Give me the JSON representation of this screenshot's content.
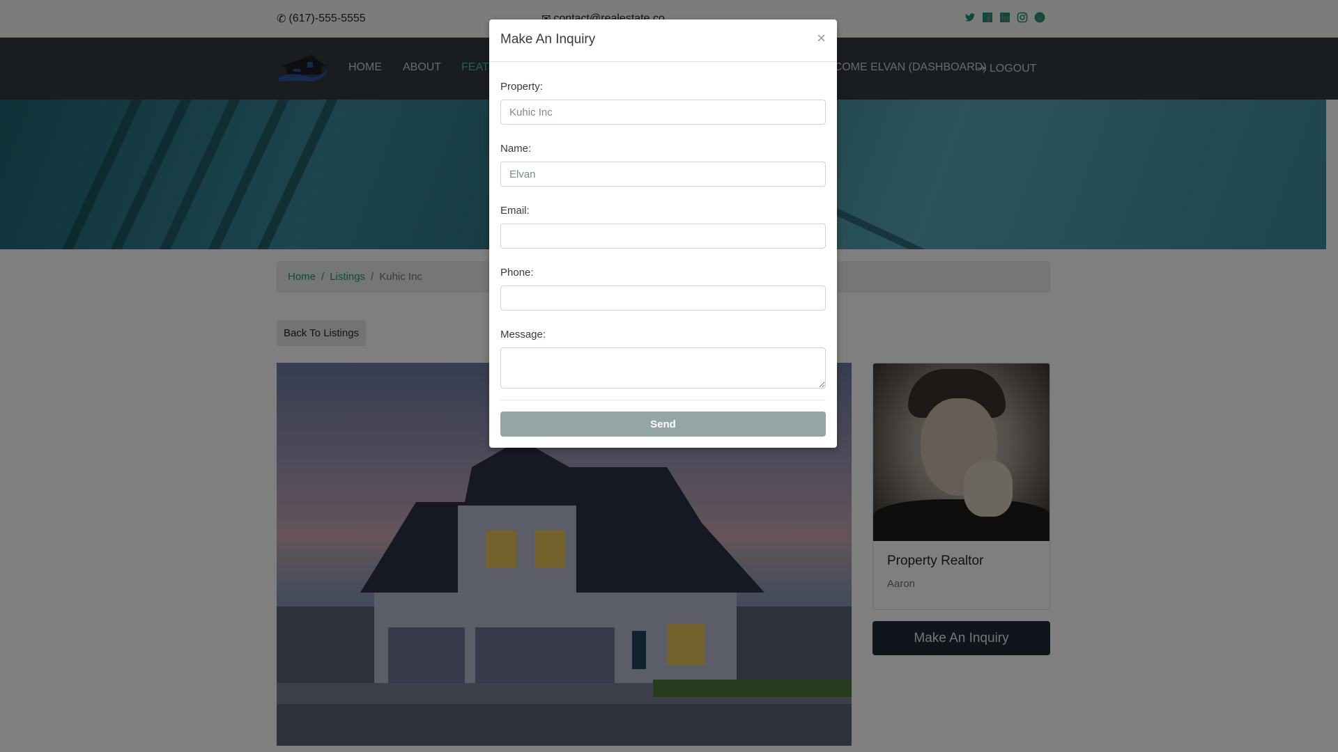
{
  "topbar": {
    "phone": "(617)-555-5555",
    "email": "contact@realestate.co",
    "social_icons": [
      "twitter-icon",
      "facebook-icon",
      "linkedin-icon",
      "instagram-icon",
      "pinterest-icon"
    ]
  },
  "nav": {
    "items": [
      {
        "label": "HOME"
      },
      {
        "label": "ABOUT"
      },
      {
        "label": "FEATURED LISTINGS",
        "active": true
      },
      {
        "label": "WELCOME ELVAN (DASHBOARD)"
      },
      {
        "label": "LOGOUT"
      }
    ]
  },
  "breadcrumb": {
    "items": [
      "Home",
      "Listings"
    ],
    "current": "Kuhic Inc",
    "separator": "/"
  },
  "back_button": "Back To Listings",
  "realtor": {
    "title": "Property Realtor",
    "name": "Aaron"
  },
  "inquiry_button": "Make An Inquiry",
  "modal": {
    "title": "Make An Inquiry",
    "close": "×",
    "fields": {
      "property": {
        "label": "Property:",
        "value": "Kuhic Inc"
      },
      "name": {
        "label": "Name:",
        "value": "Elvan"
      },
      "email": {
        "label": "Email:",
        "value": ""
      },
      "phone": {
        "label": "Phone:",
        "value": ""
      },
      "message": {
        "label": "Message:",
        "value": ""
      }
    },
    "send_label": "Send"
  },
  "colors": {
    "accent": "#1d9478",
    "nav_bg": "#343a40",
    "send_button": "#95a5a6",
    "inquiry_button": "#212936"
  }
}
